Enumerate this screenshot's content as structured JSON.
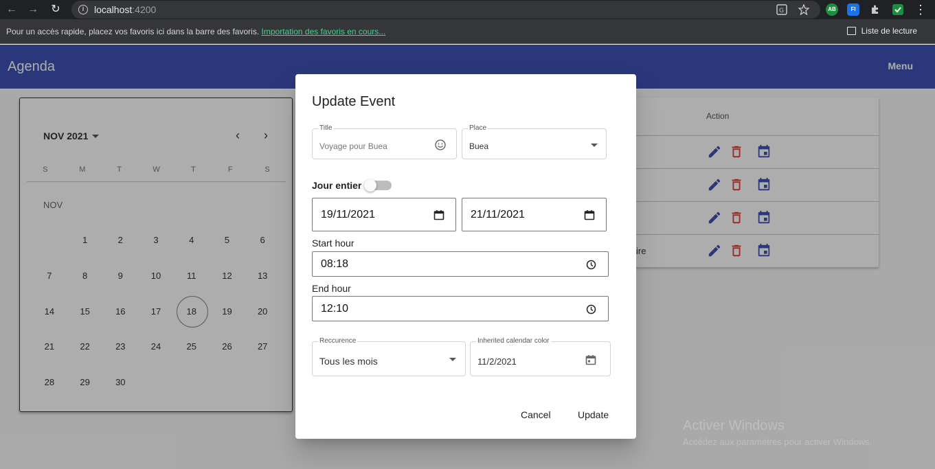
{
  "browser": {
    "url_host": "localhost",
    "url_port": ":4200",
    "bookmarks_message": "Pour un accès rapide, placez vos favoris ici dans la barre des favoris.",
    "bookmarks_link": "Importation des favoris en cours...",
    "reading_list": "Liste de lecture",
    "ext_ab": "AB",
    "ext_fi": "FI"
  },
  "toolbar": {
    "title": "Agenda",
    "menu": "Menu"
  },
  "calendar": {
    "period": "NOV 2021",
    "weekdays": [
      "S",
      "M",
      "T",
      "W",
      "T",
      "F",
      "S"
    ],
    "month_label": "NOV",
    "weeks": [
      [
        "",
        "1",
        "2",
        "3",
        "4",
        "5",
        "6"
      ],
      [
        "7",
        "8",
        "9",
        "10",
        "11",
        "12",
        "13"
      ],
      [
        "14",
        "15",
        "16",
        "17",
        "18",
        "19",
        "20"
      ],
      [
        "21",
        "22",
        "23",
        "24",
        "25",
        "26",
        "27"
      ],
      [
        "28",
        "29",
        "30",
        "",
        "",
        "",
        ""
      ]
    ],
    "today": "18"
  },
  "table": {
    "action_header": "Action",
    "rows": [
      {
        "cut_text": ""
      },
      {
        "cut_text": ""
      },
      {
        "cut_text": ""
      },
      {
        "cut_text": "ire"
      }
    ]
  },
  "dialog": {
    "title": "Update Event",
    "title_field": {
      "label": "Title",
      "placeholder": "Voyage pour Buea"
    },
    "place_field": {
      "label": "Place",
      "value": "Buea"
    },
    "all_day_label": "Jour entier",
    "all_day_on": false,
    "start_date": "19/11/2021",
    "end_date": "21/11/2021",
    "start_hour_label": "Start hour",
    "start_hour": "08:18",
    "end_hour_label": "End hour",
    "end_hour": "12:10",
    "recurrence": {
      "label": "Reccurence",
      "value": "Tous les mois"
    },
    "color": {
      "label": "Inherited calendar color",
      "value": "11/2/2021"
    },
    "cancel_label": "Cancel",
    "update_label": "Update"
  },
  "watermark": {
    "line1": "Activer Windows",
    "line2": "Accédez aux paramètres pour activer Windows."
  },
  "colors": {
    "toolbar": "#3f51b5",
    "edit_icon": "#3f51b5",
    "delete_icon": "#e53935",
    "event_icon": "#3f51b5"
  }
}
